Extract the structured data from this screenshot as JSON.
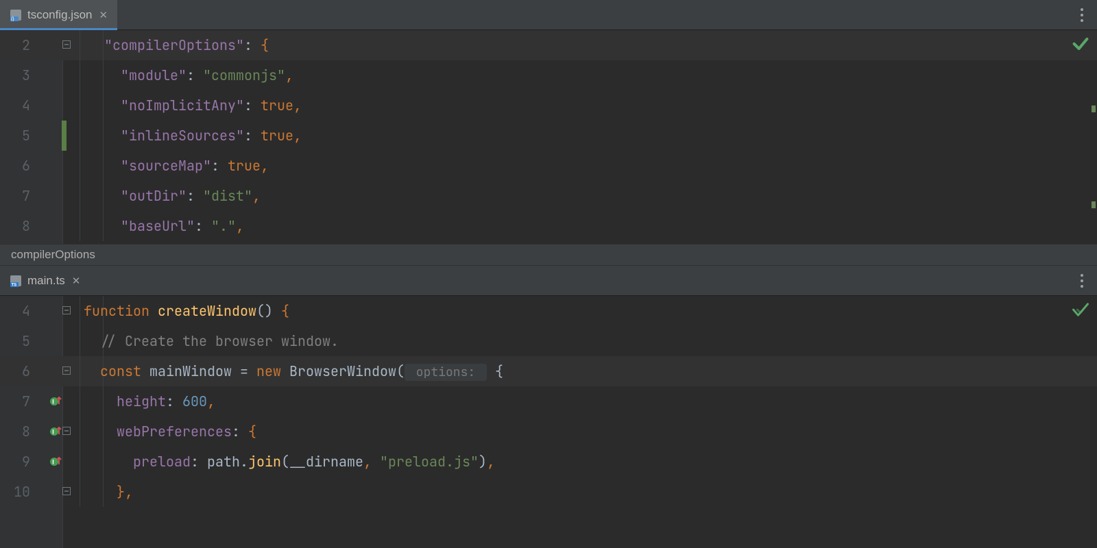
{
  "panes": {
    "top": {
      "tab": {
        "filename": "tsconfig.json",
        "active": true,
        "icon": "json-file"
      },
      "inspection": "ok-green",
      "lines": [
        {
          "n": 2,
          "hl": true,
          "fold": "minus",
          "tokens": [
            {
              "cls": "tk-key",
              "t": "\"compilerOptions\""
            },
            {
              "cls": "tk-white",
              "t": ": "
            },
            {
              "cls": "tk-punc",
              "t": "{"
            }
          ]
        },
        {
          "n": 3,
          "tokens": [
            {
              "cls": "tk-key",
              "t": "  \"module\""
            },
            {
              "cls": "tk-white",
              "t": ": "
            },
            {
              "cls": "tk-str",
              "t": "\"commonjs\""
            },
            {
              "cls": "tk-punc",
              "t": ","
            }
          ]
        },
        {
          "n": 4,
          "tokens": [
            {
              "cls": "tk-key",
              "t": "  \"noImplicitAny\""
            },
            {
              "cls": "tk-white",
              "t": ": "
            },
            {
              "cls": "tk-punc",
              "t": "true,"
            }
          ]
        },
        {
          "n": 5,
          "change": true,
          "tokens": [
            {
              "cls": "tk-key",
              "t": "  \"inlineSources\""
            },
            {
              "cls": "tk-white",
              "t": ": "
            },
            {
              "cls": "tk-punc",
              "t": "true,"
            }
          ]
        },
        {
          "n": 6,
          "tokens": [
            {
              "cls": "tk-key",
              "t": "  \"sourceMap\""
            },
            {
              "cls": "tk-white",
              "t": ": "
            },
            {
              "cls": "tk-punc",
              "t": "true,"
            }
          ]
        },
        {
          "n": 7,
          "tokens": [
            {
              "cls": "tk-key",
              "t": "  \"outDir\""
            },
            {
              "cls": "tk-white",
              "t": ": "
            },
            {
              "cls": "tk-str",
              "t": "\"dist\""
            },
            {
              "cls": "tk-punc",
              "t": ","
            }
          ]
        },
        {
          "n": 8,
          "tokens": [
            {
              "cls": "tk-key",
              "t": "  \"baseUrl\""
            },
            {
              "cls": "tk-white",
              "t": ": "
            },
            {
              "cls": "tk-str",
              "t": "\".\""
            },
            {
              "cls": "tk-punc",
              "t": ","
            }
          ]
        }
      ],
      "breadcrumb": "compilerOptions"
    },
    "bottom": {
      "tab": {
        "filename": "main.ts",
        "active": false,
        "icon": "ts-file"
      },
      "inspection": "ok-green-outline",
      "lines": [
        {
          "n": 4,
          "fold": "minus",
          "tokens": [
            {
              "cls": "tk-kw",
              "t": "function "
            },
            {
              "cls": "tk-fn",
              "t": "createWindow"
            },
            {
              "cls": "tk-ident",
              "t": "() "
            },
            {
              "cls": "tk-punc",
              "t": "{"
            }
          ]
        },
        {
          "n": 5,
          "tokens": [
            {
              "cls": "tk-comment",
              "t": "  // Create the browser window."
            }
          ]
        },
        {
          "n": 6,
          "hl": true,
          "fold": "minus",
          "tokens": [
            {
              "cls": "tk-kw",
              "t": "  const "
            },
            {
              "cls": "tk-ident",
              "t": "mainWindow "
            },
            {
              "cls": "tk-ident",
              "t": "= "
            },
            {
              "cls": "tk-kw",
              "t": "new "
            },
            {
              "cls": "tk-ident",
              "t": "BrowserWindow("
            },
            {
              "cls": "tk-hint",
              "t": " options: "
            },
            {
              "cls": "tk-ident",
              "t": " {"
            }
          ]
        },
        {
          "n": 7,
          "impl": true,
          "tokens": [
            {
              "cls": "tk-field",
              "t": "    height"
            },
            {
              "cls": "tk-white",
              "t": ": "
            },
            {
              "cls": "tk-num",
              "t": "600"
            },
            {
              "cls": "tk-punc",
              "t": ","
            }
          ]
        },
        {
          "n": 8,
          "impl": true,
          "fold": "minus",
          "tokens": [
            {
              "cls": "tk-field",
              "t": "    webPreferences"
            },
            {
              "cls": "tk-white",
              "t": ": "
            },
            {
              "cls": "tk-punc",
              "t": "{"
            }
          ]
        },
        {
          "n": 9,
          "impl": true,
          "tokens": [
            {
              "cls": "tk-field",
              "t": "      preload"
            },
            {
              "cls": "tk-white",
              "t": ": path."
            },
            {
              "cls": "tk-fn",
              "t": "join"
            },
            {
              "cls": "tk-white",
              "t": "(__dirname"
            },
            {
              "cls": "tk-punc",
              "t": ", "
            },
            {
              "cls": "tk-str",
              "t": "\"preload.js\""
            },
            {
              "cls": "tk-white",
              "t": ")"
            },
            {
              "cls": "tk-punc",
              "t": ","
            }
          ]
        },
        {
          "n": 10,
          "fold": "minus-up",
          "tokens": [
            {
              "cls": "tk-punc",
              "t": "    },"
            }
          ]
        }
      ]
    }
  }
}
